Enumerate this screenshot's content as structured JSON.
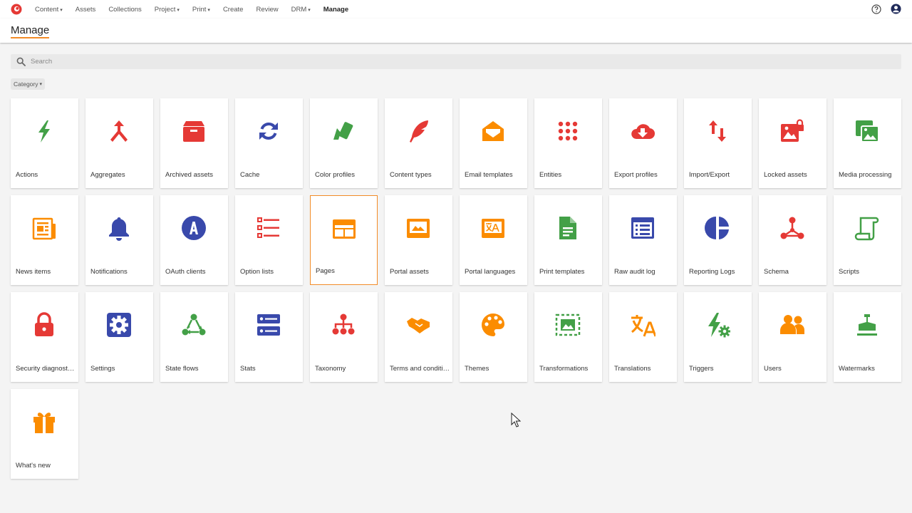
{
  "nav": {
    "logo": "app-logo",
    "items": [
      {
        "label": "Content",
        "caret": "▾"
      },
      {
        "label": "Assets",
        "caret": ""
      },
      {
        "label": "Collections",
        "caret": ""
      },
      {
        "label": "Project",
        "caret": "▾"
      },
      {
        "label": "Print",
        "caret": "▾"
      },
      {
        "label": "Create",
        "caret": ""
      },
      {
        "label": "Review",
        "caret": ""
      },
      {
        "label": "DRM",
        "caret": "▾"
      },
      {
        "label": "Manage",
        "caret": ""
      }
    ],
    "active_index": 8,
    "help_icon": "help-circle-icon",
    "user_icon": "user-account-icon"
  },
  "page": {
    "title": "Manage"
  },
  "search": {
    "placeholder": "Search",
    "value": "",
    "icon": "search-icon"
  },
  "filters": {
    "category_label": "Category",
    "caret": "▾"
  },
  "tiles": [
    {
      "label": "Actions",
      "icon": "lightning-bolt-icon",
      "color": "#43a047"
    },
    {
      "label": "Aggregates",
      "icon": "merge-arrow-icon",
      "color": "#e53935"
    },
    {
      "label": "Archived assets",
      "icon": "archive-box-icon",
      "color": "#e53935"
    },
    {
      "label": "Cache",
      "icon": "sync-arrows-icon",
      "color": "#3949ab"
    },
    {
      "label": "Color profiles",
      "icon": "color-swatches-icon",
      "color": "#43a047"
    },
    {
      "label": "Content types",
      "icon": "feather-quill-icon",
      "color": "#e53935"
    },
    {
      "label": "Email templates",
      "icon": "open-envelope-icon",
      "color": "#fb8c00"
    },
    {
      "label": "Entities",
      "icon": "dot-grid-icon",
      "color": "#e53935"
    },
    {
      "label": "Export profiles",
      "icon": "cloud-download-icon",
      "color": "#e53935"
    },
    {
      "label": "Import/Export",
      "icon": "up-down-arrows-icon",
      "color": "#e53935"
    },
    {
      "label": "Locked assets",
      "icon": "locked-image-icon",
      "color": "#e53935"
    },
    {
      "label": "Media processing",
      "icon": "image-stack-icon",
      "color": "#43a047"
    },
    {
      "label": "News items",
      "icon": "newspaper-icon",
      "color": "#fb8c00"
    },
    {
      "label": "Notifications",
      "icon": "bell-icon",
      "color": "#3949ab"
    },
    {
      "label": "OAuth clients",
      "icon": "letter-a-circle-icon",
      "color": "#3949ab"
    },
    {
      "label": "Option lists",
      "icon": "checklist-icon",
      "color": "#e53935"
    },
    {
      "label": "Pages",
      "icon": "page-layout-icon",
      "color": "#fb8c00"
    },
    {
      "label": "Portal assets",
      "icon": "picture-frame-icon",
      "color": "#fb8c00"
    },
    {
      "label": "Portal languages",
      "icon": "translate-box-icon",
      "color": "#fb8c00"
    },
    {
      "label": "Print templates",
      "icon": "document-icon",
      "color": "#43a047"
    },
    {
      "label": "Raw audit log",
      "icon": "list-window-icon",
      "color": "#3949ab"
    },
    {
      "label": "Reporting Logs",
      "icon": "pie-chart-icon",
      "color": "#3949ab"
    },
    {
      "label": "Schema",
      "icon": "node-graph-icon",
      "color": "#e53935"
    },
    {
      "label": "Scripts",
      "icon": "scroll-icon",
      "color": "#43a047"
    },
    {
      "label": "Security diagnostics",
      "icon": "padlock-icon",
      "color": "#e53935"
    },
    {
      "label": "Settings",
      "icon": "gear-icon",
      "color": "#3949ab"
    },
    {
      "label": "State flows",
      "icon": "cycle-nodes-icon",
      "color": "#43a047"
    },
    {
      "label": "Stats",
      "icon": "server-stack-icon",
      "color": "#3949ab"
    },
    {
      "label": "Taxonomy",
      "icon": "hierarchy-icon",
      "color": "#e53935"
    },
    {
      "label": "Terms and conditions",
      "icon": "handshake-icon",
      "color": "#fb8c00"
    },
    {
      "label": "Themes",
      "icon": "palette-icon",
      "color": "#fb8c00"
    },
    {
      "label": "Transformations",
      "icon": "image-transform-icon",
      "color": "#43a047"
    },
    {
      "label": "Translations",
      "icon": "translate-icon",
      "color": "#fb8c00"
    },
    {
      "label": "Triggers",
      "icon": "bolt-gear-icon",
      "color": "#43a047"
    },
    {
      "label": "Users",
      "icon": "people-group-icon",
      "color": "#fb8c00"
    },
    {
      "label": "Watermarks",
      "icon": "stamp-icon",
      "color": "#43a047"
    },
    {
      "label": "What's new",
      "icon": "gift-box-icon",
      "color": "#fb8c00"
    }
  ],
  "selected_tile": "Pages",
  "colors": {
    "accent": "#f28c28",
    "green": "#43a047",
    "red": "#e53935",
    "indigo": "#3949ab",
    "orange": "#fb8c00"
  }
}
